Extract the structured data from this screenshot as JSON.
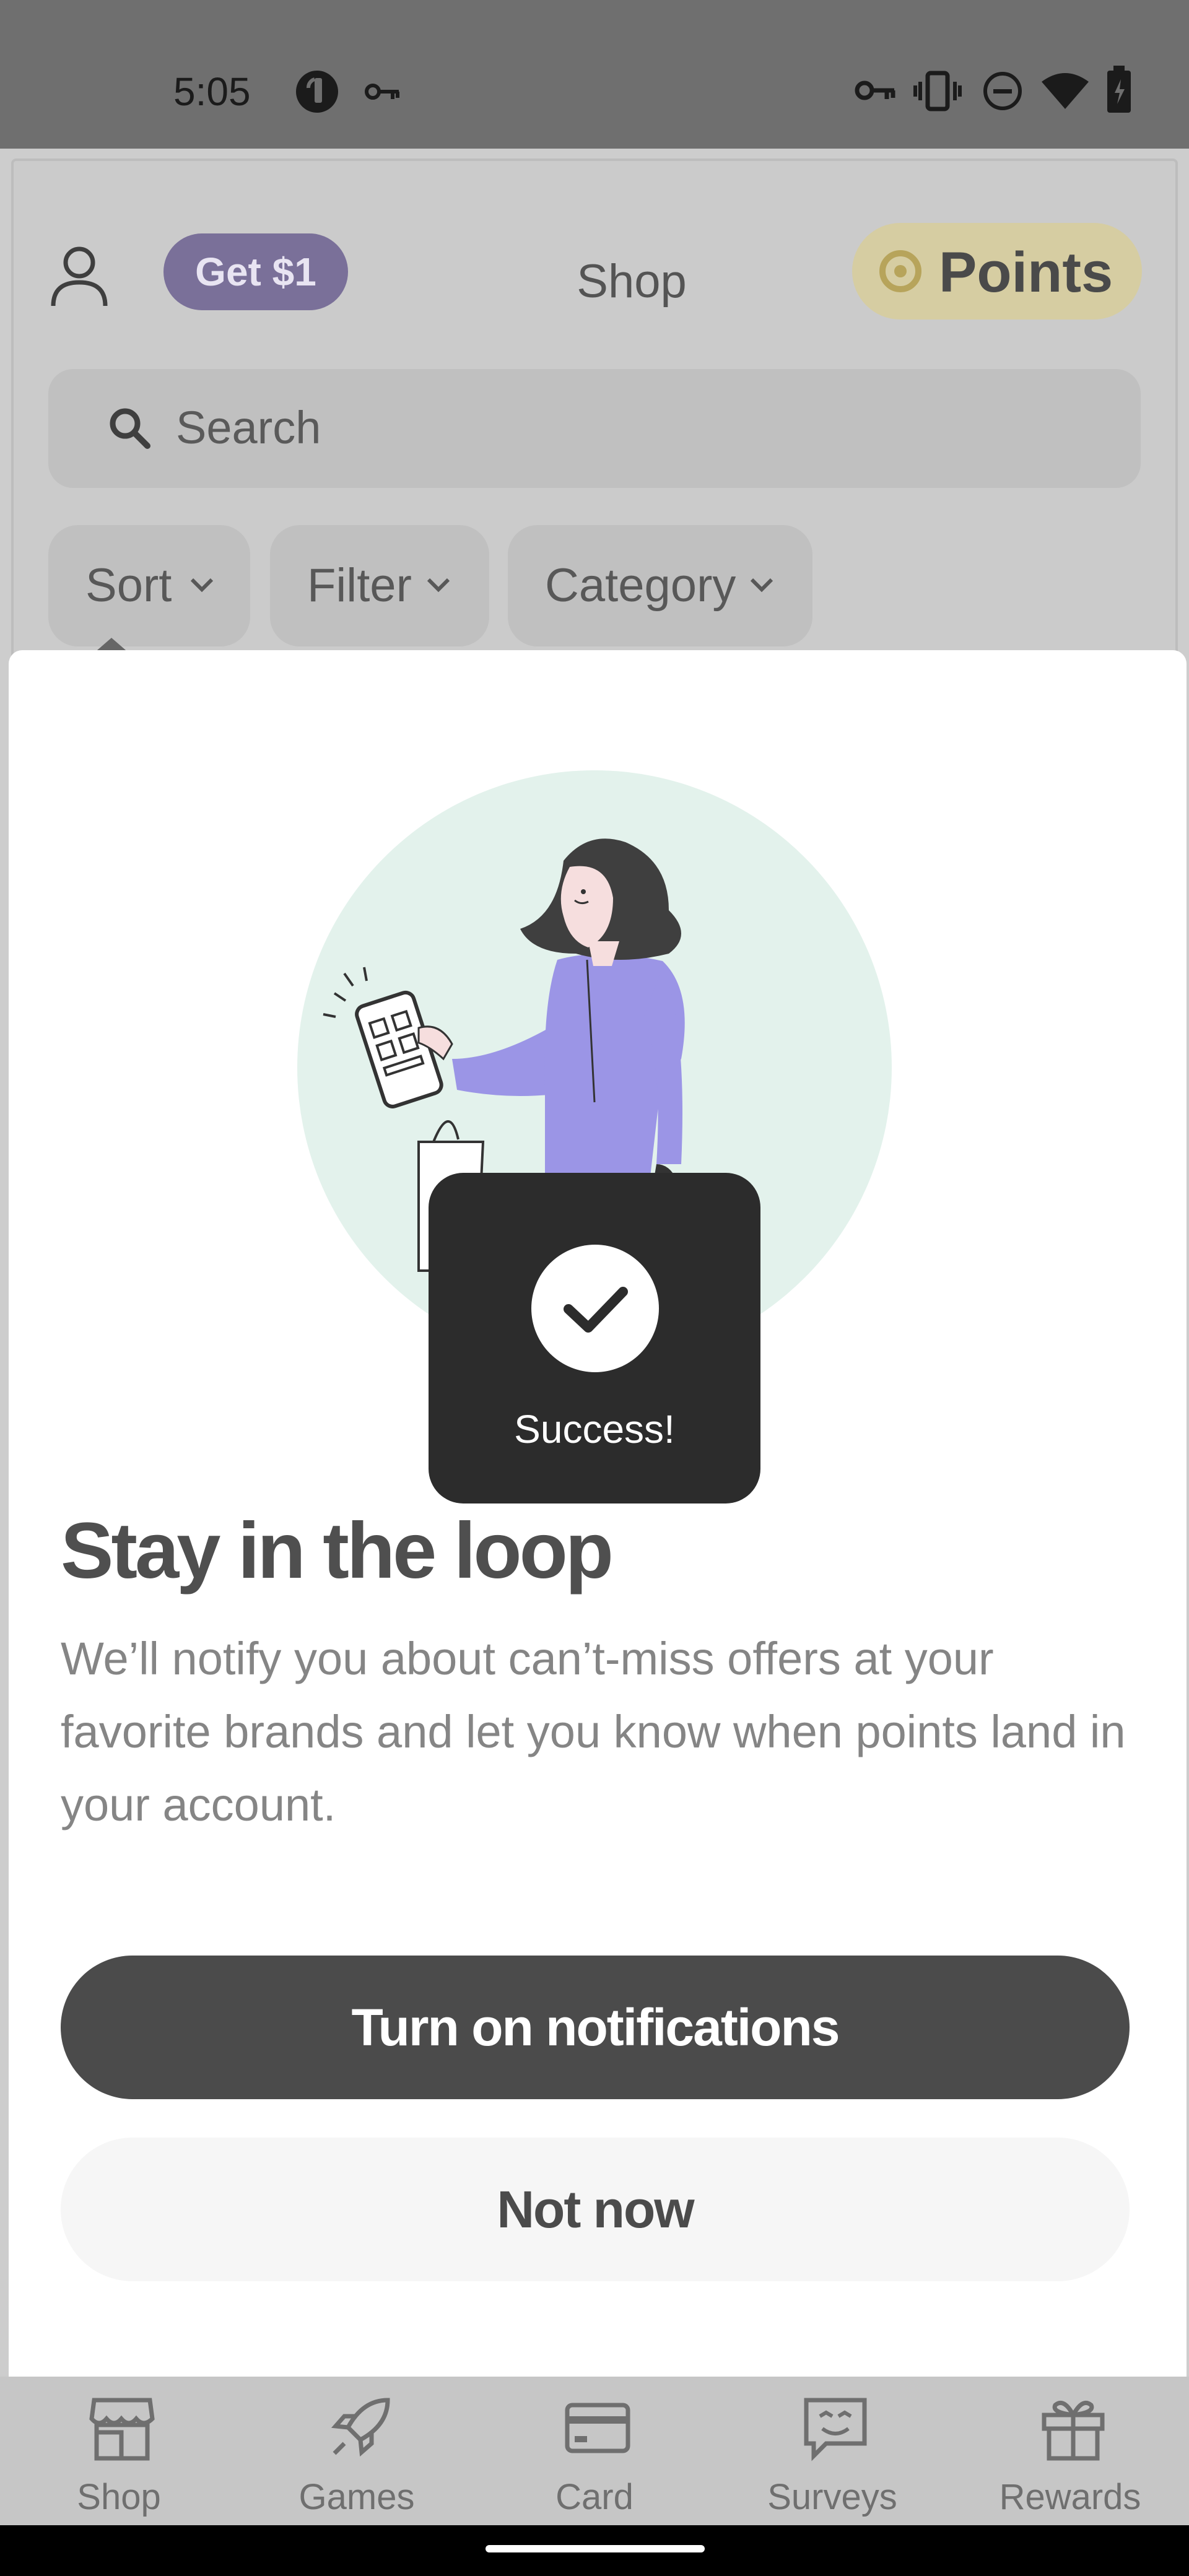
{
  "status_bar": {
    "time": "5:05",
    "left_icons": [
      "pocket-cast-icon",
      "key-icon"
    ],
    "right_icons": [
      "vpn-key-icon",
      "vibrate-icon",
      "do-not-disturb-icon",
      "wifi-icon",
      "battery-icon"
    ]
  },
  "header": {
    "profile_icon": "person-icon",
    "get_badge": "Get $1",
    "title": "Shop",
    "points_label": "Points",
    "points_icon": "coin-icon"
  },
  "search": {
    "placeholder": "Search"
  },
  "filters": [
    {
      "label": "Sort"
    },
    {
      "label": "Filter"
    },
    {
      "label": "Category"
    }
  ],
  "sheet": {
    "illustration": "woman-shopping-illustration",
    "title": "Stay in the loop",
    "body": "We’ll notify you about can’t-miss offers at your favorite brands and let you know when points land in your account.",
    "primary_label": "Turn on notifications",
    "secondary_label": "Not now"
  },
  "toast": {
    "text": "Success!",
    "icon": "check-icon"
  },
  "bottom_nav": [
    {
      "label": "Shop",
      "icon": "store-icon"
    },
    {
      "label": "Games",
      "icon": "rocket-icon"
    },
    {
      "label": "Card",
      "icon": "card-icon"
    },
    {
      "label": "Surveys",
      "icon": "survey-chat-icon"
    },
    {
      "label": "Rewards",
      "icon": "gift-icon"
    }
  ],
  "colors": {
    "accent": "#7a7099",
    "points": "#d6cda2",
    "primary_button": "#4b4b4b",
    "illustration_circle": "#e3f2ec",
    "illustration_purple": "#9b95e6"
  }
}
